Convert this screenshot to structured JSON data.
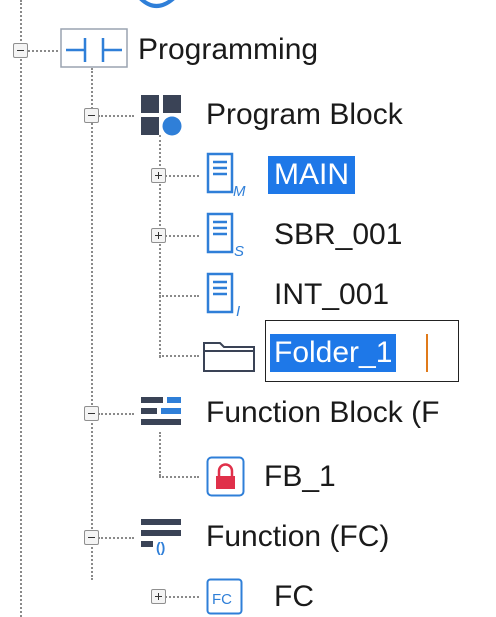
{
  "tree": {
    "programming": {
      "label": "Programming",
      "icon": "ladder-contact-icon",
      "expanded": true
    },
    "program_block": {
      "label": "Program Block",
      "icon": "blocks-icon",
      "expanded": true
    },
    "main": {
      "label": "MAIN",
      "icon": "document-m-icon",
      "selected": true
    },
    "sbr": {
      "label": "SBR_001",
      "icon": "document-s-icon"
    },
    "int": {
      "label": "INT_001",
      "icon": "document-i-icon"
    },
    "folder": {
      "label": "Folder_1",
      "icon": "folder-icon",
      "editing": true
    },
    "function_block": {
      "label": "Function Block (F",
      "icon": "function-block-icon",
      "expanded": true
    },
    "fb1": {
      "label": "FB_1",
      "icon": "locked-block-icon"
    },
    "function": {
      "label": "Function (FC)",
      "icon": "function-icon",
      "expanded": true
    },
    "fc": {
      "label": "FC",
      "icon": "fc-icon"
    }
  },
  "colors": {
    "selection": "#1e78e8",
    "icon_blue": "#2f7fd8",
    "icon_dark": "#3a4356",
    "lock_red": "#e0304a"
  }
}
